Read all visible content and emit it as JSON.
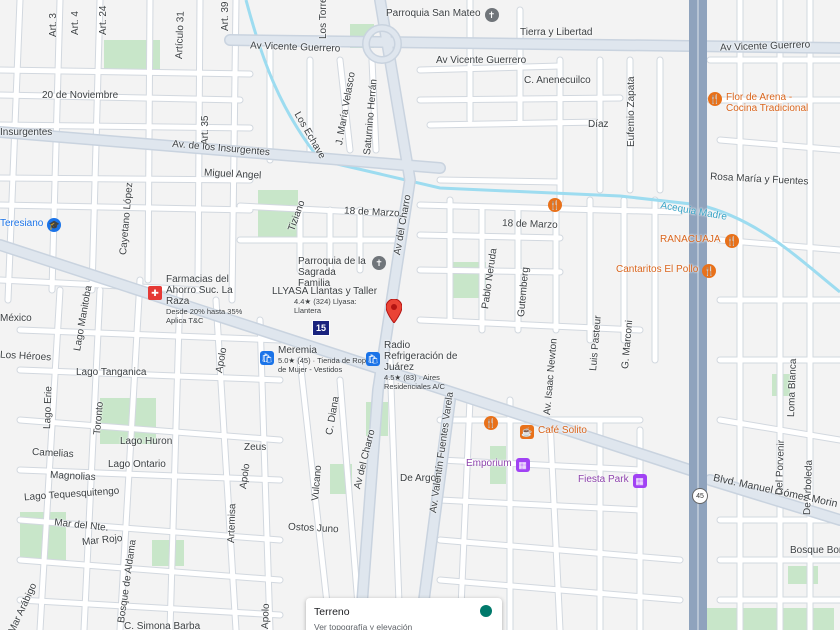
{
  "map": {
    "colors": {
      "background": "#f3f3f3",
      "road": "#ffffff",
      "road_outline": "#d5dae0",
      "major_road": "#d8e0eb",
      "highway": "#8fa3bd",
      "water": "#9ddcf0",
      "park": "#c8e6c9",
      "pin_red": "#ea4335",
      "poi_orange": "#e8711a",
      "poi_blue": "#1a73e8",
      "poi_purple": "#a142f4"
    },
    "streets": [
      {
        "name": "Art. 3",
        "icon": ""
      },
      {
        "name": "Art. 4",
        "icon": ""
      },
      {
        "name": "Art. 24",
        "icon": ""
      },
      {
        "name": "Artículo 31",
        "icon": ""
      },
      {
        "name": "Art. 39",
        "icon": ""
      },
      {
        "name": "Art. 35",
        "icon": ""
      },
      {
        "name": "Los Torres",
        "icon": ""
      },
      {
        "name": "Av Vicente Guerrero",
        "icon": ""
      },
      {
        "name": "Av Vicente Guerrero",
        "icon": ""
      },
      {
        "name": "Av Vicente Guerrero",
        "icon": ""
      },
      {
        "name": "Tierra y Libertad",
        "icon": ""
      },
      {
        "name": "20 de Noviembre",
        "icon": ""
      },
      {
        "name": "Los Echave",
        "icon": ""
      },
      {
        "name": "J. María Velasco",
        "icon": ""
      },
      {
        "name": "Saturnino Herrán",
        "icon": ""
      },
      {
        "name": "C. Anenecuilco",
        "icon": ""
      },
      {
        "name": "Eufemio Zapata",
        "icon": ""
      },
      {
        "name": "Insurgentes",
        "icon": ""
      },
      {
        "name": "Av. de los Insurgentes",
        "icon": ""
      },
      {
        "name": "Díaz",
        "icon": ""
      },
      {
        "name": "Cayetano López",
        "icon": ""
      },
      {
        "name": "Miguel Angel",
        "icon": ""
      },
      {
        "name": "Tiziano",
        "icon": ""
      },
      {
        "name": "Rosa María y Fuentes",
        "icon": ""
      },
      {
        "name": "Acequia Madre",
        "icon": ""
      },
      {
        "name": "18 de Marzo",
        "icon": ""
      },
      {
        "name": "18 de Marzo",
        "icon": ""
      },
      {
        "name": "Av del Charro",
        "icon": ""
      },
      {
        "name": "Pablo Neruda",
        "icon": ""
      },
      {
        "name": "Gutemberg",
        "icon": ""
      },
      {
        "name": "Lago Manitoba",
        "icon": ""
      },
      {
        "name": "México",
        "icon": ""
      },
      {
        "name": "Los Héroes",
        "icon": ""
      },
      {
        "name": "Lago Tanganica",
        "icon": ""
      },
      {
        "name": "Apolo",
        "icon": ""
      },
      {
        "name": "Av. Isaac Newton",
        "icon": ""
      },
      {
        "name": "Luis Pasteur",
        "icon": ""
      },
      {
        "name": "G. Marconi",
        "icon": ""
      },
      {
        "name": "Lago Erie",
        "icon": ""
      },
      {
        "name": "Toronto",
        "icon": ""
      },
      {
        "name": "Lago Huron",
        "icon": ""
      },
      {
        "name": "C. Diana",
        "icon": ""
      },
      {
        "name": "Zeus",
        "icon": ""
      },
      {
        "name": "Camelias",
        "icon": ""
      },
      {
        "name": "Lago Ontario",
        "icon": ""
      },
      {
        "name": "Magnolias",
        "icon": ""
      },
      {
        "name": "Apolo",
        "icon": ""
      },
      {
        "name": "Vulcano",
        "icon": ""
      },
      {
        "name": "Av del Charro",
        "icon": ""
      },
      {
        "name": "De Argos",
        "icon": ""
      },
      {
        "name": "Av. Valentín Fuentes Varela",
        "icon": ""
      },
      {
        "name": "Lago Tequesquitengo",
        "icon": ""
      },
      {
        "name": "Artemisa",
        "icon": ""
      },
      {
        "name": "Mar del Nte.",
        "icon": ""
      },
      {
        "name": "Mar Rojo",
        "icon": ""
      },
      {
        "name": "Ostos Juno",
        "icon": ""
      },
      {
        "name": "Bosque de Aldama",
        "icon": ""
      },
      {
        "name": "Mar Arábigo",
        "icon": ""
      },
      {
        "name": "Apolo",
        "icon": ""
      },
      {
        "name": "C. Simona Barba",
        "icon": ""
      },
      {
        "name": "Blvd. Manuel Gómez Morin",
        "icon": ""
      },
      {
        "name": "Del Porvenir",
        "icon": ""
      },
      {
        "name": "De Arboleda",
        "icon": ""
      },
      {
        "name": "Loma Blanca",
        "icon": ""
      },
      {
        "name": "Bosque Boni",
        "icon": ""
      }
    ],
    "pois": [
      {
        "title": "Parroquia San Mateo",
        "sub": "",
        "icon": "church-icon"
      },
      {
        "title": "Flor de Arena - Cocina Tradicional",
        "sub": "",
        "icon": "restaurant-icon"
      },
      {
        "title": "Teresiano",
        "sub": "",
        "icon": "school-icon"
      },
      {
        "title": "Parroquia de la Sagrada Familia",
        "sub": "",
        "icon": "church-icon"
      },
      {
        "title": "RANACUAJA",
        "sub": "",
        "icon": "restaurant-icon"
      },
      {
        "title": "Cantaritos El Pollo",
        "sub": "",
        "icon": "restaurant-icon"
      },
      {
        "title": "Farmacias del Ahorro Suc. La Raza",
        "sub": "Desde 20% hasta 35% Aplica T&C",
        "icon": "pharmacy-icon"
      },
      {
        "title": "LLYASA Llantas y Taller",
        "sub": "4.4★ (324) Llyasa: Llantera",
        "icon": "tire-shop-icon"
      },
      {
        "title": "Meremia",
        "sub": "5.0★ (45) · Tienda de Ropa de Mujer - Vestidos",
        "icon": "shopping-bag-icon"
      },
      {
        "title": "Radio Refrigeración de Juárez",
        "sub": "4.5★ (83) · Aires Residenciales A/C",
        "icon": "shopping-bag-icon"
      },
      {
        "title": "Café Solito",
        "sub": "",
        "icon": "coffee-icon"
      },
      {
        "title": "Emporium",
        "sub": "",
        "icon": "building-icon"
      },
      {
        "title": "Fiesta Park",
        "sub": "",
        "icon": "building-icon"
      }
    ],
    "highway_shields": [
      "15",
      "45"
    ],
    "terrain_card": {
      "title": "Terreno",
      "subtitle": "Ver topografía y elevación"
    }
  }
}
